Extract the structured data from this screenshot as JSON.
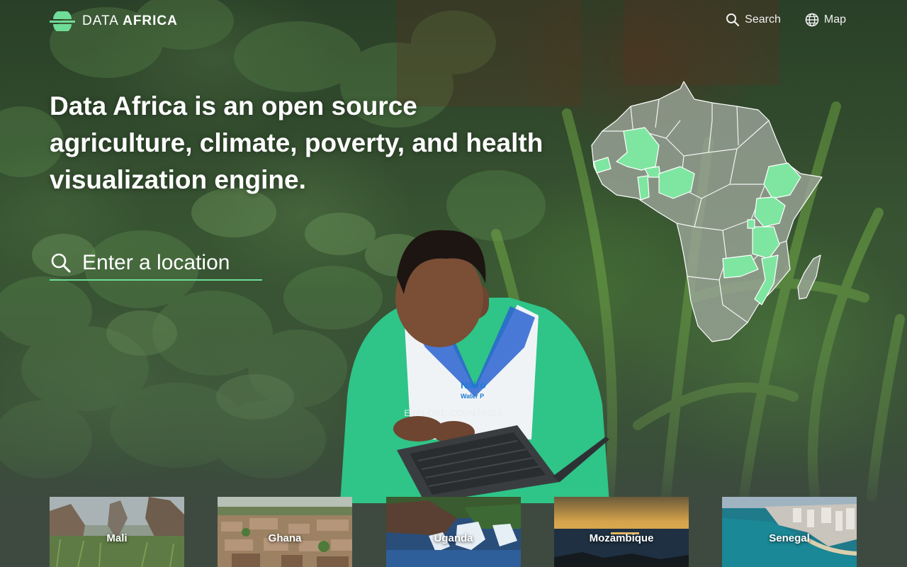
{
  "header": {
    "brand_light": "DATA",
    "brand_bold": "AFRICA",
    "nav": [
      {
        "label": "Search",
        "icon": "search-icon"
      },
      {
        "label": "Map",
        "icon": "globe-icon"
      }
    ]
  },
  "hero": {
    "headline": "Data Africa is an open source agriculture, climate, poverty, and health visualization engine.",
    "search_placeholder": "Enter a location"
  },
  "explore": {
    "label": "EXPLORE COUNTRIES",
    "countries": [
      {
        "name": "Mali"
      },
      {
        "name": "Ghana"
      },
      {
        "name": "Uganda"
      },
      {
        "name": "Mozambique"
      },
      {
        "name": "Senegal"
      }
    ]
  },
  "colors": {
    "accent": "#6fdc98",
    "map_land": "#9aa397",
    "map_highlight": "#7ee6a0"
  }
}
